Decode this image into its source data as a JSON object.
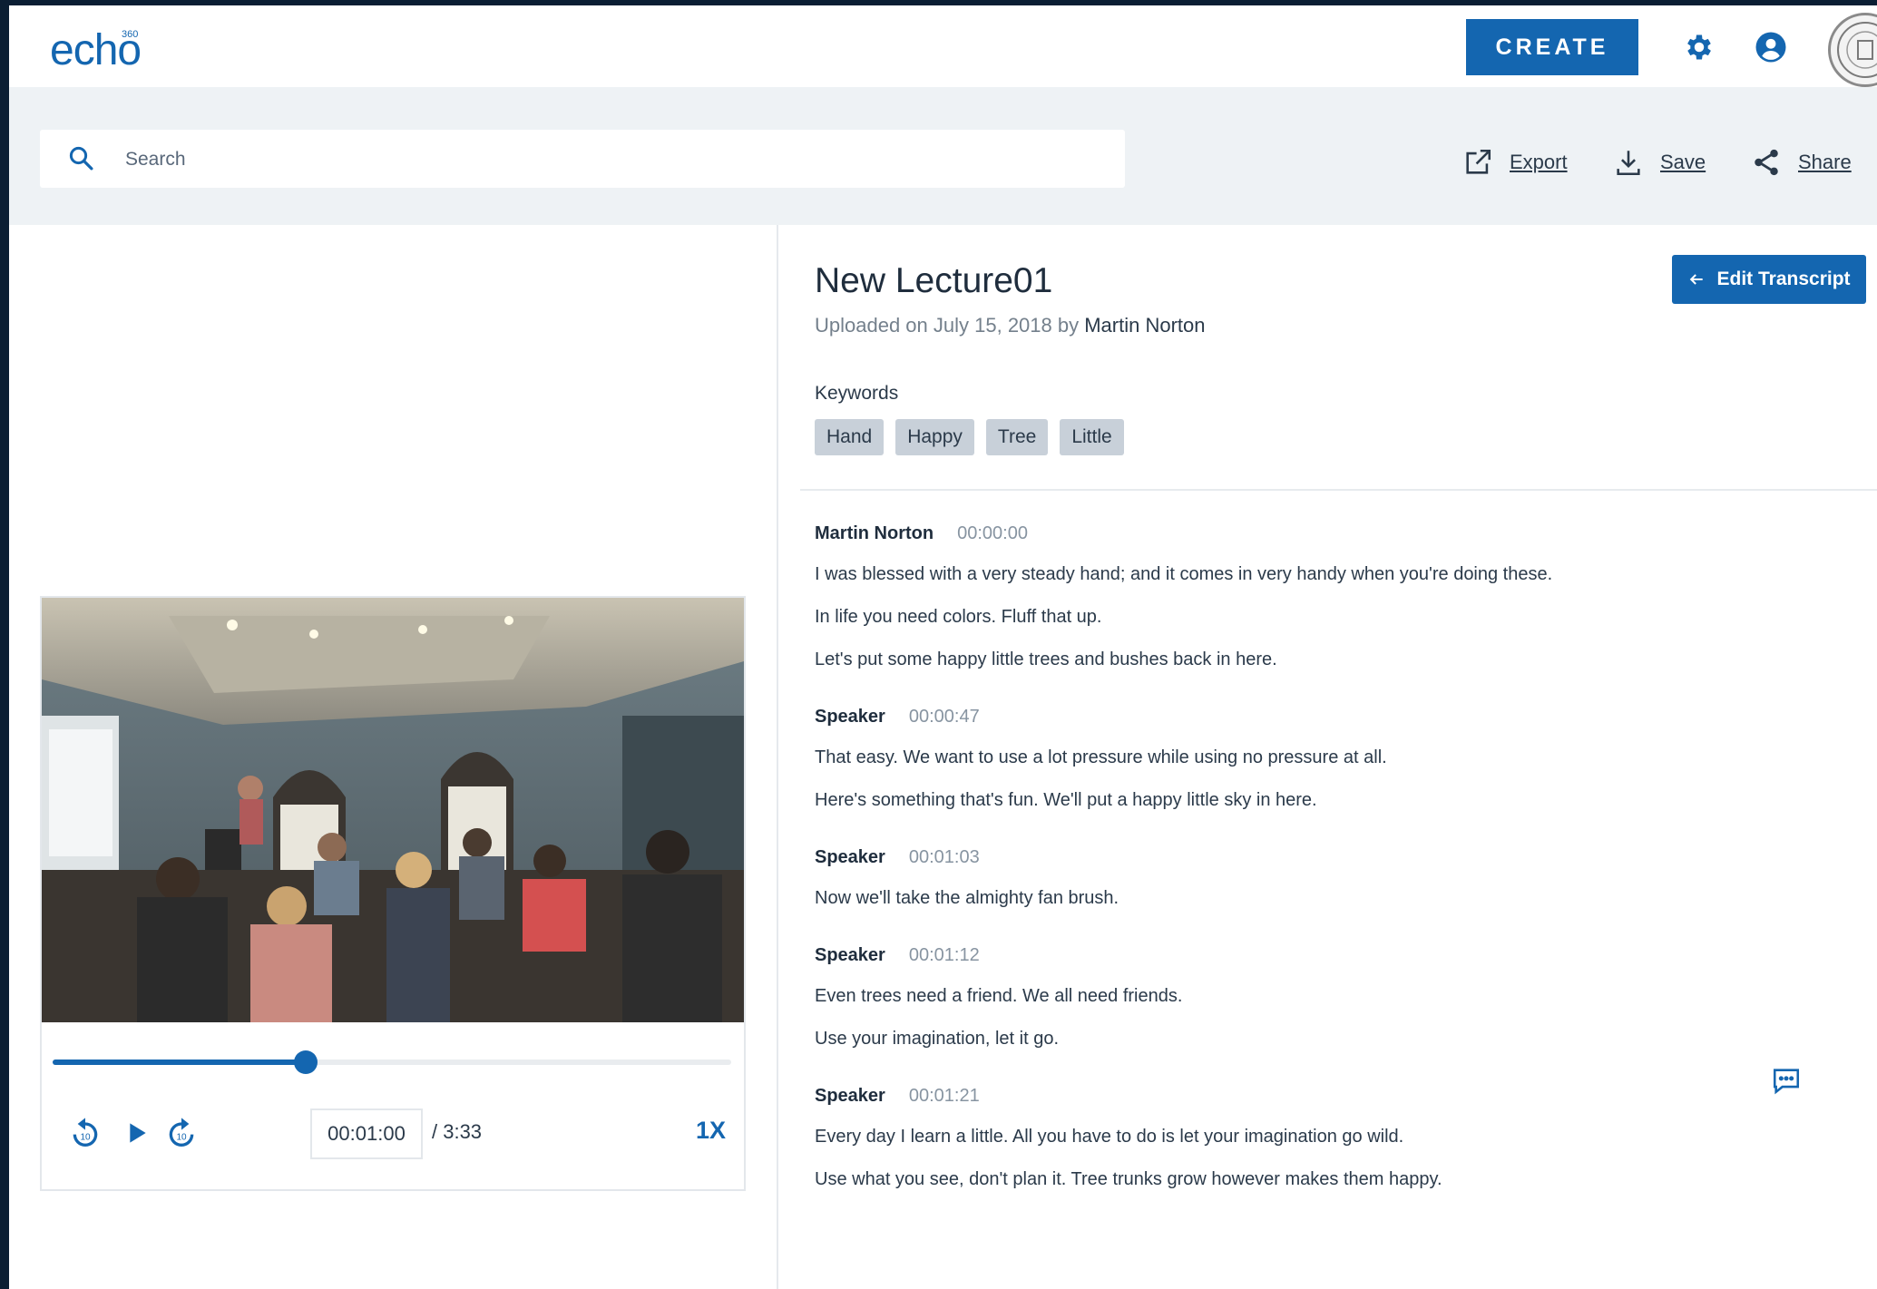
{
  "brand": {
    "name": "echo",
    "superscript": "360"
  },
  "header": {
    "create_label": "CREATE"
  },
  "search": {
    "placeholder": "Search"
  },
  "actions": {
    "export": "Export",
    "save": "Save",
    "share": "Share"
  },
  "player": {
    "current_time": "00:01:00",
    "total_time": "/ 3:33",
    "speed": "1X",
    "progress_fraction": 0.373
  },
  "lecture": {
    "title": "New Lecture01",
    "uploaded_prefix": "Uploaded on July 15, 2018 by",
    "author": "Martin Norton",
    "edit_transcript": "Edit Transcript",
    "keywords_label": "Keywords",
    "keywords": [
      "Hand",
      "Happy",
      "Tree",
      "Little"
    ]
  },
  "transcript": [
    {
      "speaker": "Martin Norton",
      "time": "00:00:00",
      "lines": [
        "I was blessed with a very steady hand; and it comes in very handy when you're doing these.",
        "In life you need colors. Fluff that up.",
        "Let's put some happy little trees and bushes back in here."
      ]
    },
    {
      "speaker": "Speaker",
      "time": "00:00:47",
      "lines": [
        "That easy. We want to use a lot pressure while using no pressure at all.",
        "Here's something that's fun. We'll put a happy little sky in here."
      ]
    },
    {
      "speaker": "Speaker",
      "time": "00:01:03",
      "lines": [
        "Now we'll take the almighty fan brush."
      ]
    },
    {
      "speaker": "Speaker",
      "time": "00:01:12",
      "lines": [
        "Even trees need a friend. We all need friends.",
        "Use your imagination, let it go."
      ]
    },
    {
      "speaker": "Speaker",
      "time": "00:01:21",
      "lines": [
        "Every day I learn a little. All you have to do is let your imagination go wild.",
        "Use what you see, don't plan it. Tree trunks grow however makes them happy."
      ]
    }
  ],
  "colors": {
    "brand_blue": "#1466b0",
    "keyword_bg": "#c8d0d9",
    "toolbar_bg": "#eef2f5"
  }
}
